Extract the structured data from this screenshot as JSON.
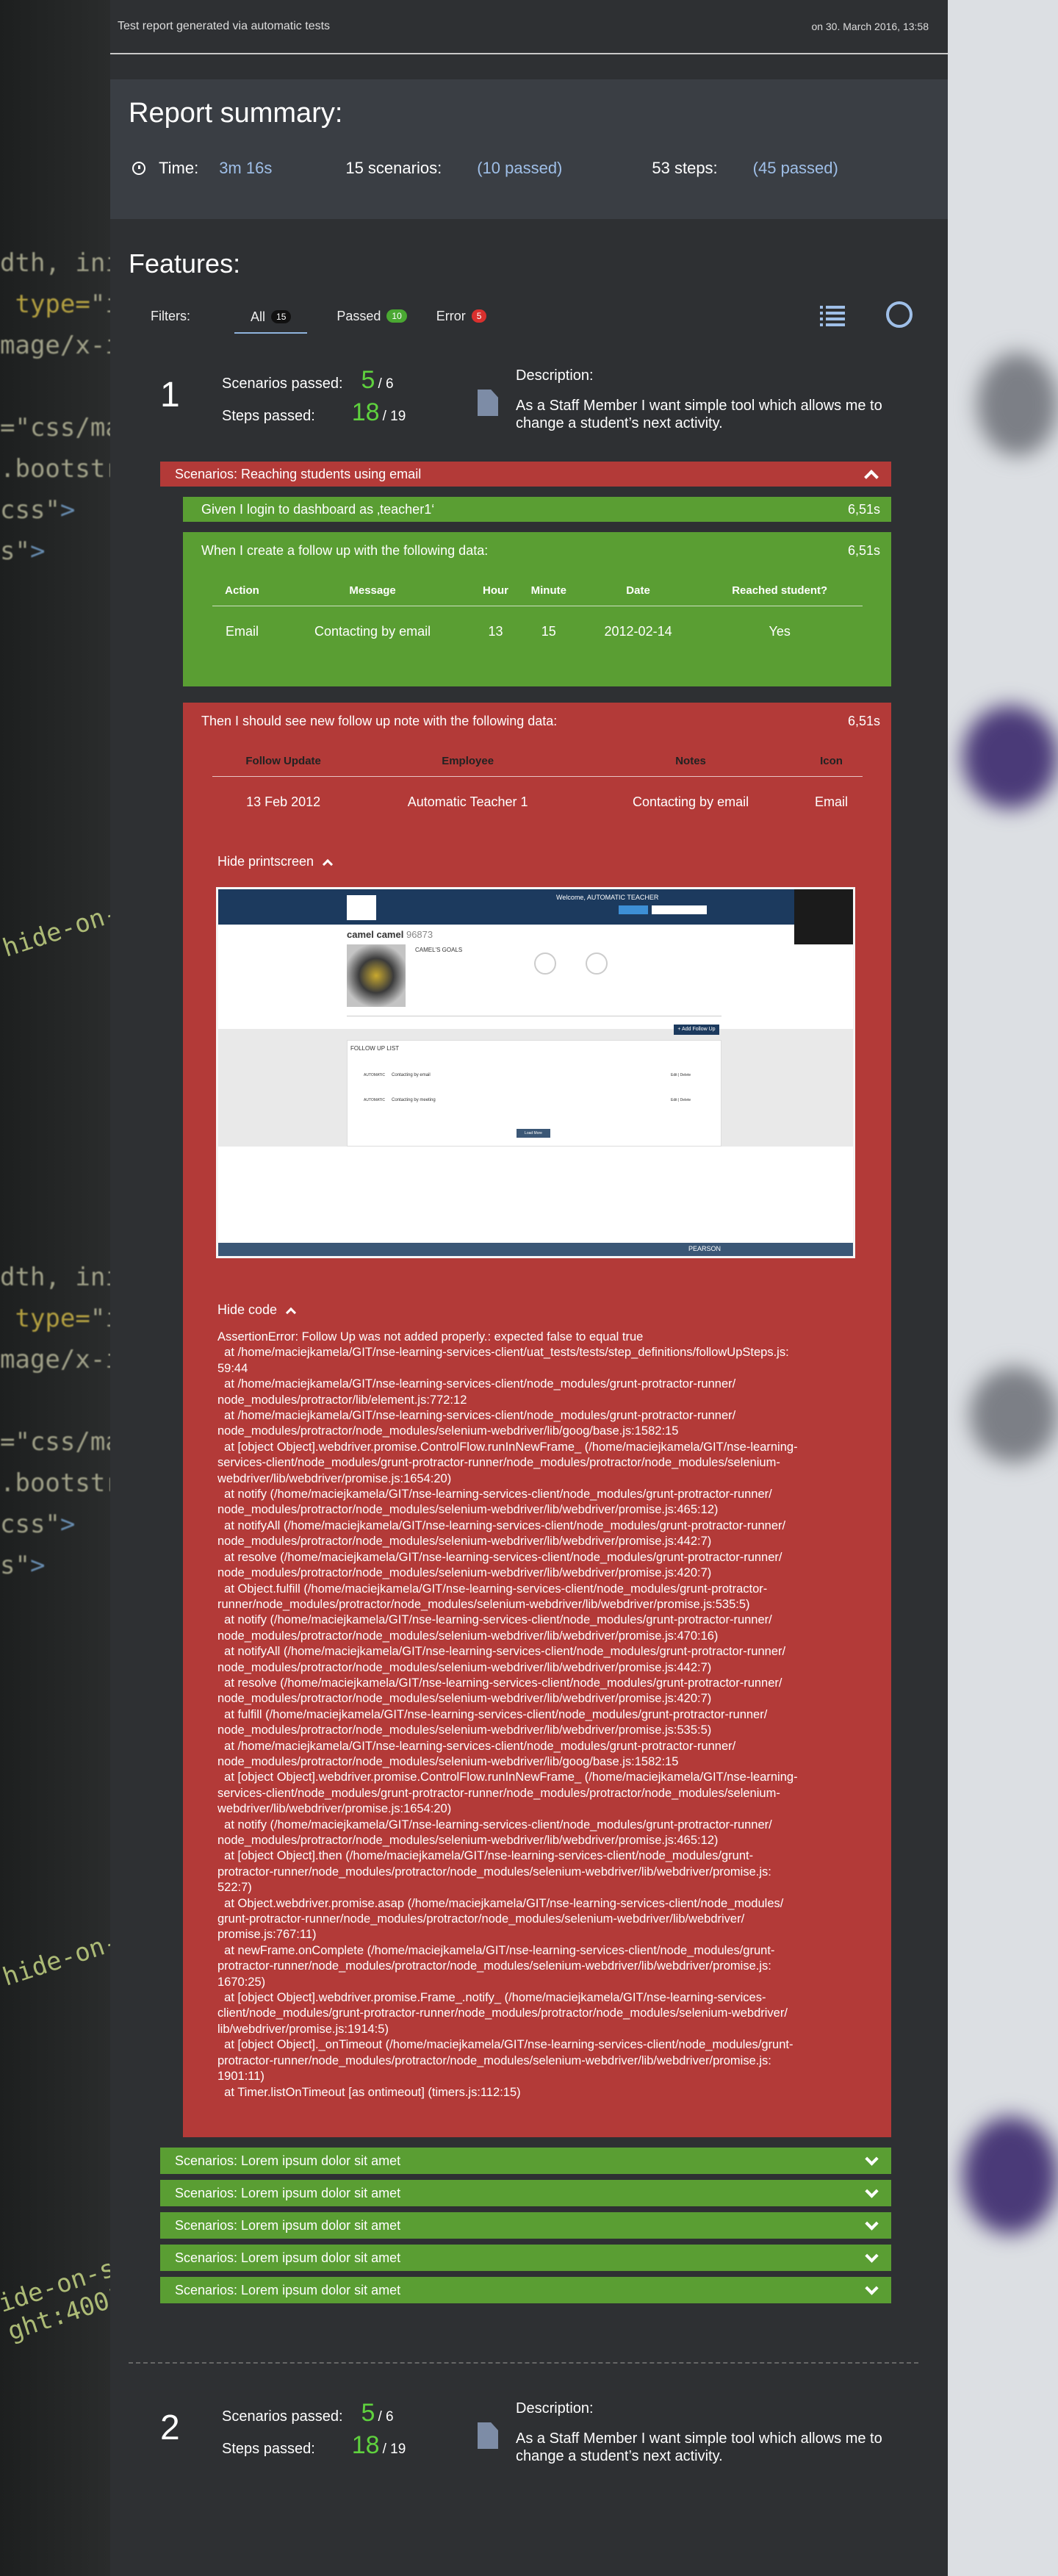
{
  "header": {
    "left_text": "Test report generated via automatic tests",
    "right_text": "on 30. March 2016, 13:58"
  },
  "summary": {
    "title": "Report summary:",
    "time_label": "Time:",
    "time_value": "3m 16s",
    "scenarios_label": "15 scenarios:",
    "scenarios_passed": "(10 passed)",
    "steps_label": "53 steps:",
    "steps_passed": "(45 passed)"
  },
  "features": {
    "title": "Features:",
    "filters_label": "Filters:",
    "filters": [
      {
        "label": "All",
        "count": "15"
      },
      {
        "label": "Passed",
        "count": "10"
      },
      {
        "label": "Error",
        "count": "5"
      }
    ]
  },
  "feature1": {
    "number": "1",
    "scenarios_label": "Scenarios passed:",
    "scenarios_passed": "5",
    "scenarios_total": "/ 6",
    "steps_label": "Steps passed:",
    "steps_passed": "18",
    "steps_total": "/ 19",
    "description_label": "Description:",
    "description": "As a Staff Member I want simple tool which allows me to change a student’s next activity.",
    "scenario_title": "Scenarios: Reaching students using email",
    "step1": {
      "text": "Given I login to dashboard as ‚teacher1‘",
      "time": "6,51s"
    },
    "step2": {
      "text": "When I create a follow up with the following data:",
      "time": "6,51s",
      "headers": [
        "Action",
        "Message",
        "Hour",
        "Minute",
        "Date",
        "Reached student?"
      ],
      "row": [
        "Email",
        "Contacting by email",
        "13",
        "15",
        "2012-02-14",
        "Yes"
      ]
    },
    "step3": {
      "text": "Then I should see new follow up note with the following data:",
      "time": "6,51s",
      "headers": [
        "Follow Update",
        "Employee",
        "Notes",
        "Icon"
      ],
      "row": [
        "13 Feb 2012",
        "Automatic Teacher 1",
        "Contacting by email",
        "Email"
      ],
      "hide_printscreen": "Hide printscreen",
      "hide_code": "Hide code",
      "screenshot": {
        "welcome": "Welcome, AUTOMATIC TEACHER",
        "student_name": "camel camel",
        "student_id": "96873",
        "goals": "CAMEL'S GOALS",
        "follow_up_list": "FOLLOW UP LIST",
        "add_follow_up": "+ Add Follow Up",
        "load_more": "Load More",
        "brand": "PEARSON",
        "notes": [
          "Contacting by email",
          "Contacting by meeting"
        ],
        "employees": [
          "AUTOMATIC",
          "AUTOMATIC"
        ],
        "actions": [
          "Edit | Delete",
          "Edit | Delete"
        ]
      },
      "code_lines": [
        "AssertionError: Follow Up was not added properly.: expected false to equal true",
        "&nbsp;&nbsp;at /home/maciejkamela/GIT/nse-learning-services-client/uat_tests/tests/step_definitions/followUpSteps.js:",
        "59:44",
        "&nbsp;&nbsp;at /home/maciejkamela/GIT/nse-learning-services-client/node_modules/grunt-protractor-runner/",
        "node_modules/protractor/lib/element.js:772:12",
        "&nbsp;&nbsp;at /home/maciejkamela/GIT/nse-learning-services-client/node_modules/grunt-protractor-runner/",
        "node_modules/protractor/node_modules/selenium-webdriver/lib/goog/base.js:1582:15",
        "&nbsp;&nbsp;at [object Object].webdriver.promise.ControlFlow.runInNewFrame_ (/home/maciejkamela/GIT/nse-learning-",
        "services-client/node_modules/grunt-protractor-runner/node_modules/protractor/node_modules/selenium-",
        "webdriver/lib/webdriver/promise.js:1654:20)",
        "&nbsp;&nbsp;at notify (/home/maciejkamela/GIT/nse-learning-services-client/node_modules/grunt-protractor-runner/",
        "node_modules/protractor/node_modules/selenium-webdriver/lib/webdriver/promise.js:465:12)",
        "&nbsp;&nbsp;at notifyAll (/home/maciejkamela/GIT/nse-learning-services-client/node_modules/grunt-protractor-runner/",
        "node_modules/protractor/node_modules/selenium-webdriver/lib/webdriver/promise.js:442:7)",
        "&nbsp;&nbsp;at resolve (/home/maciejkamela/GIT/nse-learning-services-client/node_modules/grunt-protractor-runner/",
        "node_modules/protractor/node_modules/selenium-webdriver/lib/webdriver/promise.js:420:7)",
        "&nbsp;&nbsp;at Object.fulfill (/home/maciejkamela/GIT/nse-learning-services-client/node_modules/grunt-protractor-",
        "runner/node_modules/protractor/node_modules/selenium-webdriver/lib/webdriver/promise.js:535:5)",
        "&nbsp;&nbsp;at notify (/home/maciejkamela/GIT/nse-learning-services-client/node_modules/grunt-protractor-runner/",
        "node_modules/protractor/node_modules/selenium-webdriver/lib/webdriver/promise.js:470:16)",
        "&nbsp;&nbsp;at notifyAll (/home/maciejkamela/GIT/nse-learning-services-client/node_modules/grunt-protractor-runner/",
        "node_modules/protractor/node_modules/selenium-webdriver/lib/webdriver/promise.js:442:7)",
        "&nbsp;&nbsp;at resolve (/home/maciejkamela/GIT/nse-learning-services-client/node_modules/grunt-protractor-runner/",
        "node_modules/protractor/node_modules/selenium-webdriver/lib/webdriver/promise.js:420:7)",
        "&nbsp;&nbsp;at fulfill (/home/maciejkamela/GIT/nse-learning-services-client/node_modules/grunt-protractor-runner/",
        "node_modules/protractor/node_modules/selenium-webdriver/lib/webdriver/promise.js:535:5)",
        "&nbsp;&nbsp;at /home/maciejkamela/GIT/nse-learning-services-client/node_modules/grunt-protractor-runner/",
        "node_modules/protractor/node_modules/selenium-webdriver/lib/goog/base.js:1582:15",
        "&nbsp;&nbsp;at [object Object].webdriver.promise.ControlFlow.runInNewFrame_ (/home/maciejkamela/GIT/nse-learning-",
        "services-client/node_modules/grunt-protractor-runner/node_modules/protractor/node_modules/selenium-",
        "webdriver/lib/webdriver/promise.js:1654:20)",
        "&nbsp;&nbsp;at notify (/home/maciejkamela/GIT/nse-learning-services-client/node_modules/grunt-protractor-runner/",
        "node_modules/protractor/node_modules/selenium-webdriver/lib/webdriver/promise.js:465:12)",
        "&nbsp;&nbsp;at [object Object].then (/home/maciejkamela/GIT/nse-learning-services-client/node_modules/grunt-",
        "protractor-runner/node_modules/protractor/node_modules/selenium-webdriver/lib/webdriver/promise.js:",
        "522:7)",
        "&nbsp;&nbsp;at Object.webdriver.promise.asap (/home/maciejkamela/GIT/nse-learning-services-client/node_modules/",
        "grunt-protractor-runner/node_modules/protractor/node_modules/selenium-webdriver/lib/webdriver/",
        "promise.js:767:11)",
        "&nbsp;&nbsp;at newFrame.onComplete (/home/maciejkamela/GIT/nse-learning-services-client/node_modules/grunt-",
        "protractor-runner/node_modules/protractor/node_modules/selenium-webdriver/lib/webdriver/promise.js:",
        "1670:25)",
        "&nbsp;&nbsp;at [object Object].webdriver.promise.Frame_.notify_ (/home/maciejkamela/GIT/nse-learning-services-",
        "client/node_modules/grunt-protractor-runner/node_modules/protractor/node_modules/selenium-webdriver/",
        "lib/webdriver/promise.js:1914:5)",
        "&nbsp;&nbsp;at [object Object]._onTimeout (/home/maciejkamela/GIT/nse-learning-services-client/node_modules/grunt-",
        "protractor-runner/node_modules/protractor/node_modules/selenium-webdriver/lib/webdriver/promise.js:",
        "1901:11)",
        "&nbsp;&nbsp;at Timer.listOnTimeout [as ontimeout] (timers.js:112:15)"
      ]
    },
    "collapsed_scenarios": [
      "Scenarios: Lorem ipsum dolor sit amet",
      "Scenarios: Lorem ipsum dolor sit amet",
      "Scenarios: Lorem ipsum dolor sit amet",
      "Scenarios: Lorem ipsum dolor sit amet",
      "Scenarios: Lorem ipsum dolor sit amet"
    ]
  },
  "feature2": {
    "number": "2",
    "scenarios_label": "Scenarios passed:",
    "scenarios_passed": "5",
    "scenarios_total": "/ 6",
    "steps_label": "Steps passed:",
    "steps_passed": "18",
    "steps_total": "/ 19",
    "description_label": "Description:",
    "description": "As a Staff Member I want simple tool which allows me to change a student’s next activity."
  },
  "colors": {
    "passed": "#5a9e33",
    "failed": "#b33a38",
    "accent": "#9fbfe8"
  }
}
